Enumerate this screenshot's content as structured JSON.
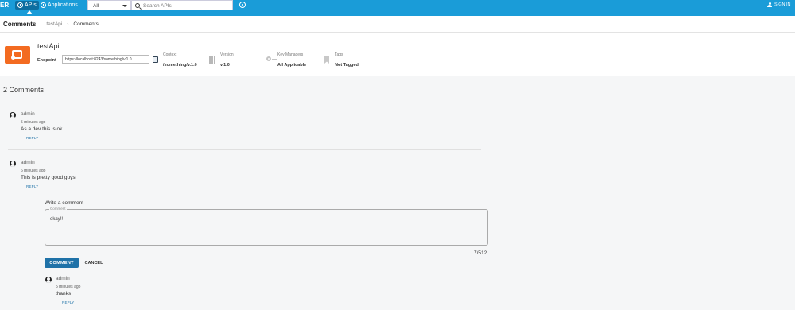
{
  "topbar": {
    "brand": "ER",
    "tabs": [
      {
        "label": "APIs",
        "icon": "api-icon",
        "active": true
      },
      {
        "label": "Applications",
        "icon": "applications-icon",
        "active": false
      }
    ],
    "filter_select": {
      "value": "All"
    },
    "search": {
      "placeholder": "Search APIs"
    },
    "user": {
      "label": "SIGN IN"
    }
  },
  "breadcrumb": {
    "title": "Comments",
    "api_link": "testApi",
    "current": "Comments"
  },
  "api": {
    "name": "testApi",
    "endpoint_label": "Endpoint",
    "endpoint_value": "https://localhost:8243/something/v.1.0",
    "context": {
      "label": "Context",
      "value": "/something/v.1.0"
    },
    "version": {
      "label": "Version",
      "value": "v.1.0"
    },
    "key_managers": {
      "label": "Key Managers",
      "value": "All Applicable"
    },
    "tags": {
      "label": "Tags",
      "value": "Not Tagged"
    },
    "brand_color": "#f36b21"
  },
  "comments": {
    "heading": "2 Comments",
    "items": [
      {
        "author": "admin",
        "time": "5 minutes ago",
        "text": "As a dev this is ok",
        "reply": "REPLY"
      },
      {
        "author": "admin",
        "time": "6 minutes ago",
        "text": "This is pretty good guys",
        "reply": "REPLY"
      }
    ],
    "reply_form": {
      "label": "Write a comment",
      "field_legend": "Comment",
      "value": "okay!!",
      "counter": "7/512",
      "submit": "COMMENT",
      "cancel": "CANCEL"
    },
    "replies": [
      {
        "author": "admin",
        "time": "5 minutes ago",
        "text": "thanks",
        "reply": "REPLY"
      }
    ]
  },
  "colors": {
    "topbar": "#1a9cd8",
    "accent": "#1f72a8"
  }
}
